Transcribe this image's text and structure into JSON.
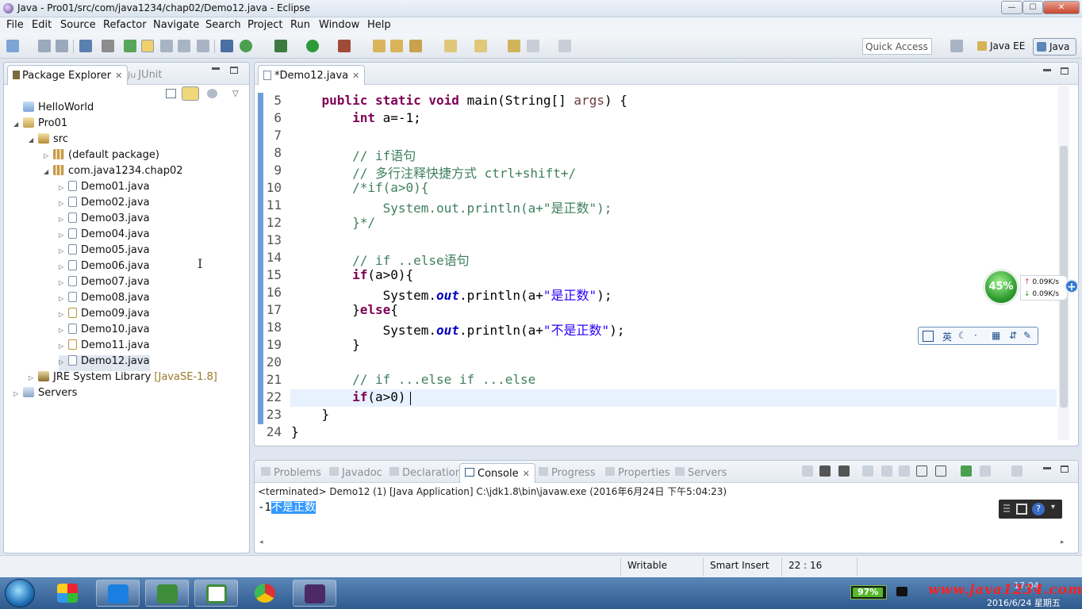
{
  "window": {
    "title": "Java - Pro01/src/com/java1234/chap02/Demo12.java - Eclipse",
    "min": "—",
    "max": "☐",
    "close": "✕"
  },
  "menu": [
    "File",
    "Edit",
    "Source",
    "Refactor",
    "Navigate",
    "Search",
    "Project",
    "Run",
    "Window",
    "Help"
  ],
  "toolbar": {
    "quick_access": "Quick Access"
  },
  "perspectives": {
    "javaee": "Java EE",
    "java": "Java"
  },
  "package_explorer": {
    "tabs": {
      "package_explorer": "Package Explorer",
      "junit": "JUnit",
      "junit_prefix": "Ju"
    },
    "tree": [
      {
        "label": "HelloWorld",
        "depth": 0,
        "icon": "folder-icon",
        "expanded": false
      },
      {
        "label": "Pro01",
        "depth": 0,
        "icon": "project-icon",
        "expanded": true
      },
      {
        "label": "src",
        "depth": 1,
        "icon": "src-folder-icon",
        "expanded": true
      },
      {
        "label": "(default package)",
        "depth": 2,
        "icon": "package-icon",
        "expanded": false
      },
      {
        "label": "com.java1234.chap02",
        "depth": 2,
        "icon": "package-icon",
        "expanded": true
      },
      {
        "label": "Demo01.java",
        "depth": 3,
        "icon": "java-file-icon"
      },
      {
        "label": "Demo02.java",
        "depth": 3,
        "icon": "java-file-icon"
      },
      {
        "label": "Demo03.java",
        "depth": 3,
        "icon": "java-file-icon"
      },
      {
        "label": "Demo04.java",
        "depth": 3,
        "icon": "java-file-icon"
      },
      {
        "label": "Demo05.java",
        "depth": 3,
        "icon": "java-file-icon"
      },
      {
        "label": "Demo06.java",
        "depth": 3,
        "icon": "java-file-icon"
      },
      {
        "label": "Demo07.java",
        "depth": 3,
        "icon": "java-file-icon"
      },
      {
        "label": "Demo08.java",
        "depth": 3,
        "icon": "java-file-icon"
      },
      {
        "label": "Demo09.java",
        "depth": 3,
        "icon": "java-file-warning-icon"
      },
      {
        "label": "Demo10.java",
        "depth": 3,
        "icon": "java-file-icon"
      },
      {
        "label": "Demo11.java",
        "depth": 3,
        "icon": "java-file-warning-icon"
      },
      {
        "label": "Demo12.java",
        "depth": 3,
        "icon": "java-file-icon",
        "selected": true
      },
      {
        "label": "JRE System Library",
        "suffix": "[JavaSE-1.8]",
        "depth": 1,
        "icon": "jre-library-icon",
        "expanded": false
      },
      {
        "label": "Servers",
        "depth": 0,
        "icon": "servers-folder-icon",
        "expanded": false
      }
    ]
  },
  "editor": {
    "tab": "*Demo12.java",
    "lines": [
      {
        "num": "5",
        "tokens": [
          [
            "",
            "    "
          ],
          [
            "kw",
            "public static void "
          ],
          [
            "",
            "main(String[] "
          ],
          [
            "pm",
            "args"
          ],
          [
            "",
            ") {"
          ]
        ]
      },
      {
        "num": "6",
        "tokens": [
          [
            "",
            "        "
          ],
          [
            "kw",
            "int "
          ],
          [
            "",
            "a=-1;"
          ]
        ]
      },
      {
        "num": "7",
        "tokens": []
      },
      {
        "num": "8",
        "tokens": [
          [
            "",
            "        "
          ],
          [
            "cm",
            "// if语句"
          ]
        ]
      },
      {
        "num": "9",
        "tokens": [
          [
            "",
            "        "
          ],
          [
            "cm",
            "// 多行注释快捷方式 ctrl+shift+/"
          ]
        ]
      },
      {
        "num": "10",
        "tokens": [
          [
            "",
            "        "
          ],
          [
            "cm",
            "/*if(a>0){"
          ]
        ]
      },
      {
        "num": "11",
        "tokens": [
          [
            "",
            "            "
          ],
          [
            "cm",
            "System.out.println(a+\"是正数\");"
          ]
        ]
      },
      {
        "num": "12",
        "tokens": [
          [
            "",
            "        "
          ],
          [
            "cm",
            "}*/"
          ]
        ]
      },
      {
        "num": "13",
        "tokens": []
      },
      {
        "num": "14",
        "tokens": [
          [
            "",
            "        "
          ],
          [
            "cm",
            "// if ..else语句"
          ]
        ]
      },
      {
        "num": "15",
        "tokens": [
          [
            "",
            "        "
          ],
          [
            "kw",
            "if"
          ],
          [
            "",
            "(a>0){"
          ]
        ]
      },
      {
        "num": "16",
        "tokens": [
          [
            "",
            "            System."
          ],
          [
            "fd",
            "out"
          ],
          [
            "",
            ".println(a+"
          ],
          [
            "st",
            "\"是正数\""
          ],
          [
            "",
            ");"
          ]
        ]
      },
      {
        "num": "17",
        "tokens": [
          [
            "",
            "        }"
          ],
          [
            "kw",
            "else"
          ],
          [
            "",
            "{"
          ]
        ]
      },
      {
        "num": "18",
        "tokens": [
          [
            "",
            "            System."
          ],
          [
            "fd",
            "out"
          ],
          [
            "",
            ".println(a+"
          ],
          [
            "st",
            "\"不是正数\""
          ],
          [
            "",
            ");"
          ]
        ]
      },
      {
        "num": "19",
        "tokens": [
          [
            "",
            "        }"
          ]
        ]
      },
      {
        "num": "20",
        "tokens": []
      },
      {
        "num": "21",
        "tokens": [
          [
            "",
            "        "
          ],
          [
            "cm",
            "// if ...else if ...else"
          ]
        ]
      },
      {
        "num": "22",
        "tokens": [
          [
            "",
            "        "
          ],
          [
            "kw",
            "if"
          ],
          [
            "",
            "(a>0)"
          ]
        ]
      },
      {
        "num": "23",
        "tokens": [
          [
            "",
            "    }"
          ]
        ]
      },
      {
        "num": "24",
        "tokens": [
          [
            "",
            "}"
          ]
        ]
      }
    ]
  },
  "bottom_panel": {
    "tabs": [
      "Problems",
      "Javadoc",
      "Declaration",
      "Console",
      "Progress",
      "Properties",
      "Servers"
    ],
    "active_tab": "Console",
    "console_header": "<terminated> Demo12 (1) [Java Application] C:\\jdk1.8\\bin\\javaw.exe (2016年6月24日 下午5:04:23)",
    "output_prefix": "-1",
    "output_selected": "不是正数"
  },
  "statusbar": {
    "writable": "Writable",
    "insert_mode": "Smart Insert",
    "position": "22 : 16"
  },
  "overlay": {
    "net_percent": "45%",
    "upload": "0.09K/s",
    "download": "0.09K/s",
    "ime_lang": "英"
  },
  "taskbar": {
    "battery": "97%",
    "watermark": "www.java1234.com",
    "date": "2016/6/24 星期五",
    "time": "17:04"
  },
  "colors": {
    "keyword": "#7f0055",
    "comment": "#3f7f5f",
    "string": "#2a00ff",
    "field": "#0000c0",
    "selection": "#3399ff"
  }
}
